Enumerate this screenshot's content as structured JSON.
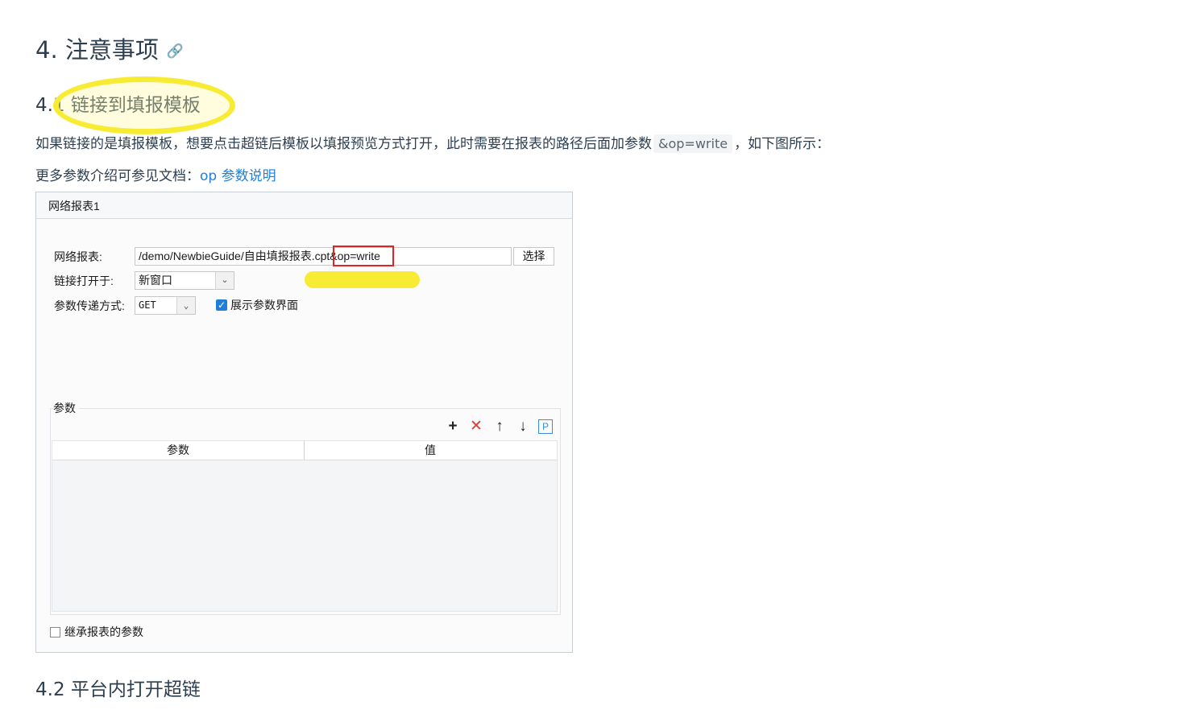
{
  "section": {
    "title": "4. 注意事项",
    "anchor_icon": "link-icon"
  },
  "subsection1": {
    "title": "4.1 链接到填报模板"
  },
  "paragraph1": {
    "before": "如果链接的是填报模板，想要点击超链后模板以填报预览方式打开，此时需要在报表的路径后面加参数",
    "code": "&op=write",
    "after": "，如下图所示："
  },
  "paragraph2": {
    "before": "更多参数介绍可参见文档：",
    "link": "op 参数说明"
  },
  "dialog": {
    "tab_label": "网络报表1",
    "url_label": "网络报表:",
    "url_value": "/demo/NewbieGuide/自由填报报表.cpt&op=write",
    "choose_label": "选择",
    "open_label": "链接打开于:",
    "open_value": "新窗口",
    "method_label": "参数传递方式:",
    "method_value": "GET",
    "show_params_label": "展示参数界面",
    "show_params_checked": true,
    "params_group_label": "参数",
    "toolbar": {
      "add": "+",
      "delete": "✕",
      "up": "↑",
      "down": "↓",
      "param": "P"
    },
    "table_headers": [
      "参数",
      "值"
    ],
    "inherit_label": "继承报表的参数",
    "inherit_checked": false
  },
  "subsection2": {
    "title": "4.2 平台内打开超链"
  },
  "colors": {
    "link": "#1f7fd8",
    "highlight": "#f7ec33",
    "annotation_red": "#e02424",
    "text": "#2c3e50"
  }
}
